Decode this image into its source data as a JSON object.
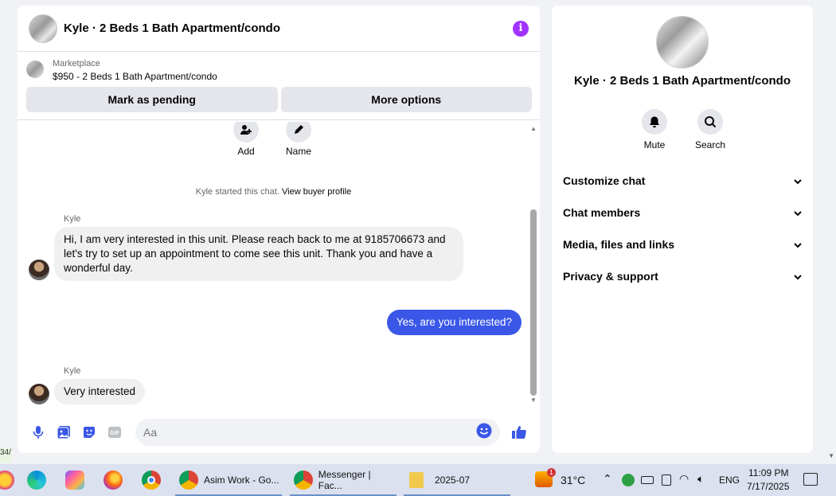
{
  "chat": {
    "title": "Kyle · 2 Beds 1 Bath Apartment/condo",
    "listing_source": "Marketplace",
    "listing_title": "$950 - 2 Beds 1 Bath Apartment/condo",
    "mark_pending_label": "Mark as pending",
    "more_options_label": "More options",
    "quick_actions": [
      {
        "label": "Add",
        "icon": "add-person-icon"
      },
      {
        "label": "Name",
        "icon": "pencil-icon"
      }
    ],
    "started_text": "Kyle started this chat.",
    "view_profile_link": "View buyer profile",
    "messages": [
      {
        "sender": "Kyle",
        "text": "Hi, I am very interested in this unit. Please reach back to me at 9185706673 and let's try to set up an appointment to come see this unit. Thank you and have a wonderful day.",
        "direction": "in"
      },
      {
        "sender": "",
        "text": "Yes, are you interested?",
        "direction": "out"
      },
      {
        "sender": "Kyle",
        "text": "Very interested",
        "direction": "in"
      }
    ],
    "composer_placeholder": "Aa",
    "accent_color": "#3a57e8"
  },
  "info_panel": {
    "title": "Kyle · 2 Beds 1 Bath Apartment/condo",
    "actions": [
      {
        "label": "Mute",
        "icon": "bell-icon"
      },
      {
        "label": "Search",
        "icon": "search-icon"
      }
    ],
    "sections": [
      "Customize chat",
      "Chat members",
      "Media, files and links",
      "Privacy & support"
    ]
  },
  "taskbar": {
    "apps": [
      {
        "label": "Asim Work - Go..."
      },
      {
        "label": "Messenger | Fac..."
      },
      {
        "label": "2025-07"
      }
    ],
    "weather": "31°C",
    "weather_badge": "1",
    "language": "ENG",
    "time": "11:09 PM",
    "date": "7/17/2025",
    "left_tag": "34/"
  }
}
